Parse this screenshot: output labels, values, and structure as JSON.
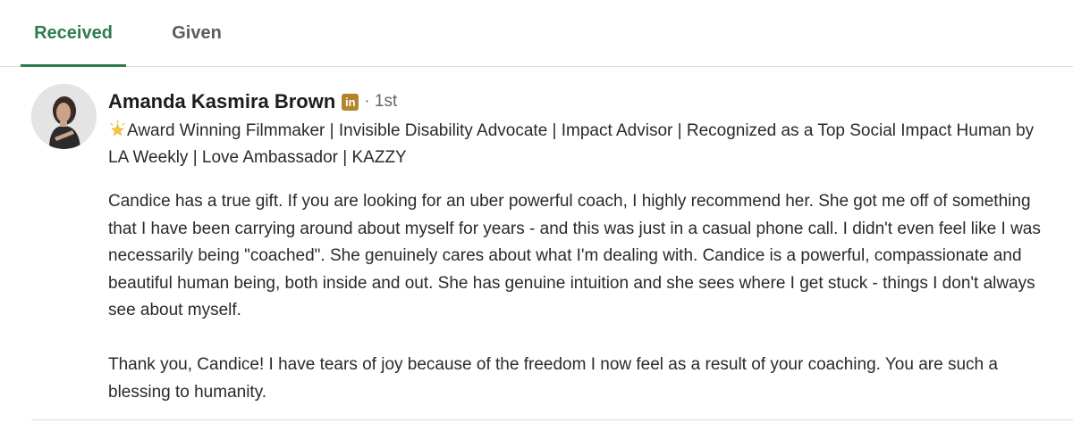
{
  "tabs": {
    "received_label": "Received",
    "given_label": "Given",
    "active": "Received"
  },
  "recommendation": {
    "author_name": "Amanda Kasmira Brown",
    "badge_label": "in",
    "connection_degree": "· 1st",
    "headline_icon": "star-icon",
    "headline": "Award Winning Filmmaker | Invisible Disability Advocate | Impact Advisor | Recognized as a Top Social Impact Human by LA Weekly | Love Ambassador | KAZZY",
    "paragraphs": [
      "Candice has a true gift. If you are looking for an uber powerful coach, I highly recommend her. She got me off of something that I have been carrying around about myself for years - and this was just in a casual phone call. I didn't even feel like I was necessarily being \"coached\". She genuinely cares about what I'm dealing with. Candice is a powerful, compassionate and beautiful human being, both inside and out. She has genuine intuition and she sees where I get stuck - things I don't always see about myself.",
      "Thank you, Candice! I have tears of joy because of the freedom I now feel as a result of your coaching. You are such a blessing to humanity."
    ]
  },
  "colors": {
    "accent_green": "#2f7d4e",
    "badge_gold": "#b3842a",
    "divider": "#dcdcdc"
  }
}
